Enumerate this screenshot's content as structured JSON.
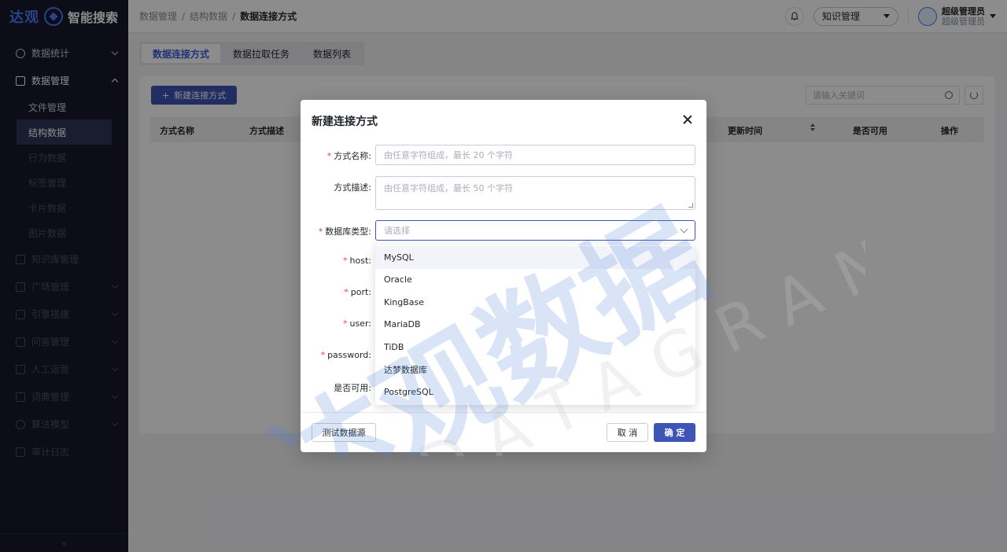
{
  "logo": {
    "brand": "达观",
    "product": "智能搜索"
  },
  "sidebar": {
    "items": [
      {
        "label": "数据统计"
      },
      {
        "label": "数据管理"
      },
      {
        "label": "知识库管理"
      },
      {
        "label": "广场管理"
      },
      {
        "label": "引擎搭建"
      },
      {
        "label": "问答管理"
      },
      {
        "label": "人工运营"
      },
      {
        "label": "词典管理"
      },
      {
        "label": "算法模型"
      },
      {
        "label": "审计日志"
      }
    ],
    "sub_items": [
      {
        "label": "文件管理"
      },
      {
        "label": "结构数据"
      },
      {
        "label": "行为数据"
      },
      {
        "label": "标签管理"
      },
      {
        "label": "卡片数据"
      },
      {
        "label": "图片数据"
      }
    ],
    "collapse": "«"
  },
  "header": {
    "breadcrumb": [
      "数据管理",
      "结构数据",
      "数据连接方式"
    ],
    "separator": "/",
    "kb_select": "知识管理",
    "user_name": "超级管理员",
    "user_role": "超级管理员"
  },
  "tabs": [
    "数据连接方式",
    "数据拉取任务",
    "数据列表"
  ],
  "toolbar": {
    "new_button": "新建连接方式",
    "plus": "+",
    "search_placeholder": "请输入关键词"
  },
  "table": {
    "headers": [
      "方式名称",
      "方式描述",
      "更新时间",
      "是否可用",
      "操作"
    ]
  },
  "modal": {
    "title": "新建连接方式",
    "fields": {
      "name_label": "方式名称:",
      "name_placeholder": "由任意字符组成，最长 20 个字符",
      "desc_label": "方式描述:",
      "desc_placeholder": "由任意字符组成，最长 50 个字符",
      "dbtype_label": "数据库类型:",
      "dbtype_placeholder": "请选择",
      "host_label": "host:",
      "port_label": "port:",
      "user_label": "user:",
      "password_label": "password:",
      "enabled_label": "是否可用:",
      "required_mark": "*"
    },
    "db_options": [
      "MySQL",
      "Oracle",
      "KingBase",
      "MariaDB",
      "TiDB",
      "达梦数据库",
      "PostgreSQL"
    ],
    "test_button": "测试数据源",
    "cancel_button": "取 消",
    "ok_button": "确 定"
  },
  "watermark": {
    "text": "达观数据",
    "sub": "DATAGRAND"
  },
  "colors": {
    "primary": "#3f55b5",
    "sidebar": "#16192a",
    "required": "#f53f3f"
  }
}
